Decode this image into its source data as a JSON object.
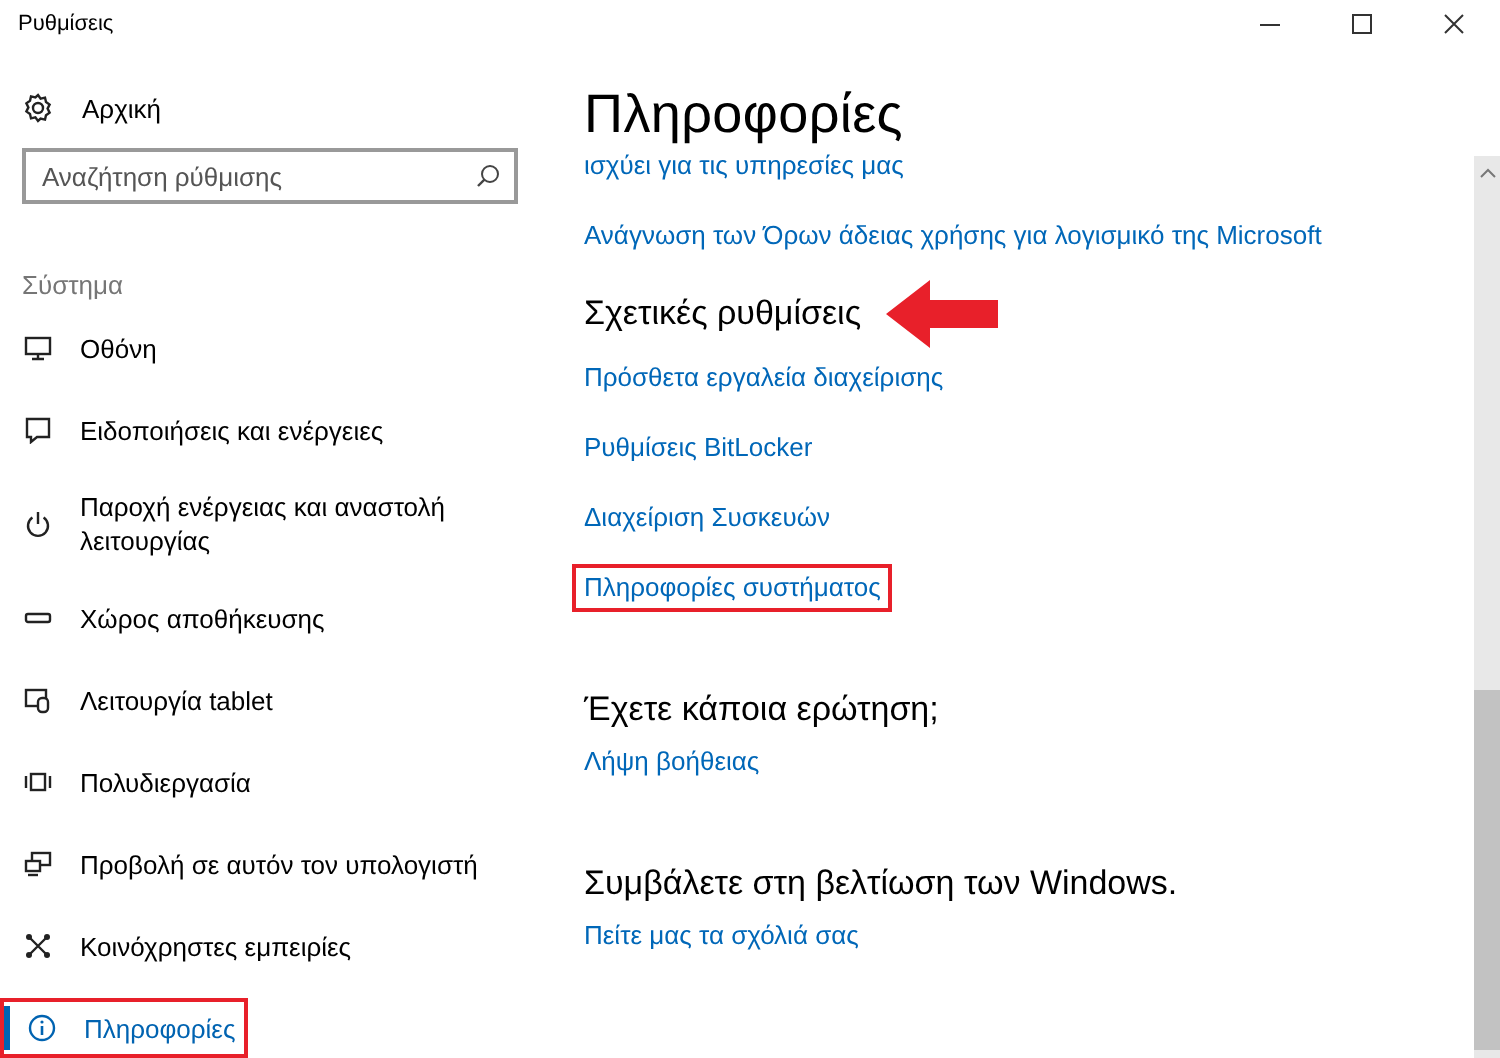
{
  "window": {
    "title": "Ρυθμίσεις"
  },
  "sidebar": {
    "home": {
      "label": "Αρχική"
    },
    "search": {
      "placeholder": "Αναζήτηση ρύθμισης"
    },
    "group_label": "Σύστημα",
    "items": [
      {
        "label": "Οθόνη",
        "selected": false,
        "highlighted": false
      },
      {
        "label": "Ειδοποιήσεις και ενέργειες",
        "selected": false,
        "highlighted": false
      },
      {
        "label": "Παροχή ενέργειας και αναστολή λειτουργίας",
        "selected": false,
        "highlighted": false
      },
      {
        "label": "Χώρος αποθήκευσης",
        "selected": false,
        "highlighted": false
      },
      {
        "label": "Λειτουργία tablet",
        "selected": false,
        "highlighted": false
      },
      {
        "label": "Πολυδιεργασία",
        "selected": false,
        "highlighted": false
      },
      {
        "label": "Προβολή σε αυτόν τον υπολογιστή",
        "selected": false,
        "highlighted": false
      },
      {
        "label": "Κοινόχρηστες εμπειρίες",
        "selected": false,
        "highlighted": false
      },
      {
        "label": "Πληροφορίες",
        "selected": true,
        "highlighted": true
      }
    ]
  },
  "content": {
    "title": "Πληροφορίες",
    "sections": [
      {
        "links": [
          {
            "label": "ισχύει για τις υπηρεσίες μας",
            "highlighted": false
          },
          {
            "label": "Ανάγνωση των Όρων άδειας χρήσης για λογισμικό της Microsoft",
            "highlighted": false
          }
        ]
      },
      {
        "heading": "Σχετικές ρυθμίσεις",
        "arrow": true,
        "links": [
          {
            "label": "Πρόσθετα εργαλεία διαχείρισης",
            "highlighted": false
          },
          {
            "label": "Ρυθμίσεις BitLocker",
            "highlighted": false
          },
          {
            "label": "Διαχείριση Συσκευών",
            "highlighted": false
          },
          {
            "label": "Πληροφορίες συστήματος",
            "highlighted": true
          }
        ]
      },
      {
        "heading": "Έχετε κάποια ερώτηση;",
        "arrow": false,
        "links": [
          {
            "label": "Λήψη βοήθειας",
            "highlighted": false
          }
        ]
      },
      {
        "heading": "Συμβάλετε στη βελτίωση των Windows.",
        "arrow": false,
        "links": [
          {
            "label": "Πείτε μας τα σχόλιά σας",
            "highlighted": false
          }
        ]
      }
    ]
  }
}
